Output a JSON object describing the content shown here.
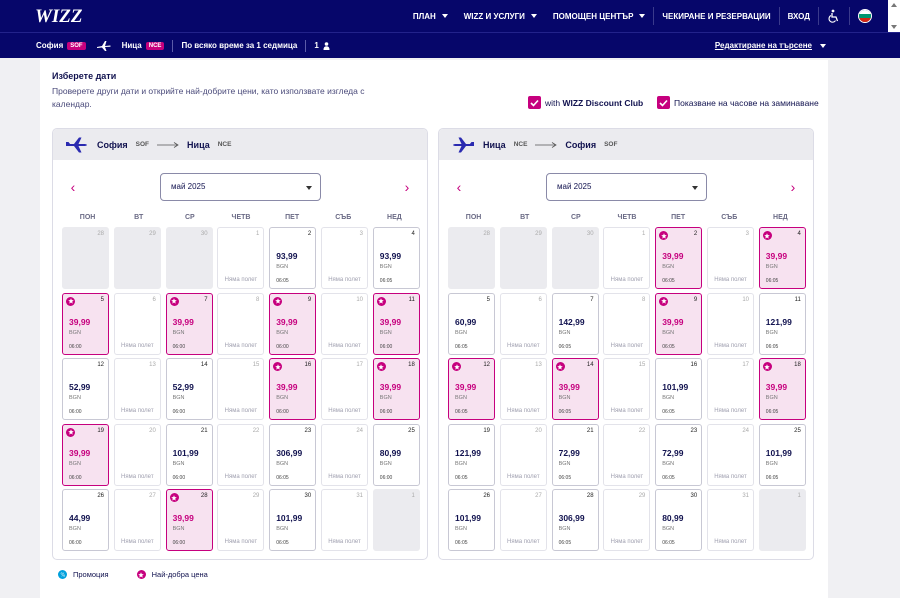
{
  "nav": {
    "logo": "WIZZ",
    "items": [
      {
        "label": "ПЛАН",
        "dropdown": true
      },
      {
        "label": "WIZZ И УСЛУГИ",
        "dropdown": true
      },
      {
        "label": "ПОМОЩЕН ЦЕНТЪР",
        "dropdown": true
      },
      {
        "label": "ЧЕКИРАНЕ И РЕЗЕРВАЦИИ",
        "dropdown": false
      },
      {
        "label": "ВХОД",
        "dropdown": false
      }
    ]
  },
  "search": {
    "origin": "София",
    "origin_code": "SOF",
    "destination": "Ница",
    "destination_code": "NCE",
    "period": "По всяко време за 1 седмица",
    "passengers": "1",
    "edit_label": "Редактиране на търсене"
  },
  "page": {
    "title": "Изберете дати",
    "subtitle": "Проверете други дати и открийте най-добрите цени, като използвате изгледа с календар.",
    "discount_club_prefix": "with ",
    "discount_club_bold": "WIZZ Discount Club",
    "show_times_label": "Показване на часове на заминаване"
  },
  "weekdays": [
    "ПОН",
    "ВТ",
    "СР",
    "ЧЕТВ",
    "ПЕТ",
    "СЪБ",
    "НЕД"
  ],
  "no_flight_label": "Няма полет",
  "currency": "BGN",
  "colors": {
    "brand_navy": "#06066a",
    "accent_pink": "#c6007e",
    "promo_blue": "#00a0dc"
  },
  "calendars": [
    {
      "from": "София",
      "from_code": "SOF",
      "to": "Ница",
      "to_code": "NCE",
      "month": "май 2025",
      "days": [
        {
          "d": "28",
          "s": "empty"
        },
        {
          "d": "29",
          "s": "empty"
        },
        {
          "d": "30",
          "s": "empty"
        },
        {
          "d": "1",
          "s": "none"
        },
        {
          "d": "2",
          "s": "price",
          "p": "93,99",
          "t": "06:05"
        },
        {
          "d": "3",
          "s": "none"
        },
        {
          "d": "4",
          "s": "price",
          "p": "93,99",
          "t": "06:05"
        },
        {
          "d": "5",
          "s": "best",
          "p": "39,99",
          "t": "06:00"
        },
        {
          "d": "6",
          "s": "none"
        },
        {
          "d": "7",
          "s": "best",
          "p": "39,99",
          "t": "06:00"
        },
        {
          "d": "8",
          "s": "none"
        },
        {
          "d": "9",
          "s": "best",
          "p": "39,99",
          "t": "06:00"
        },
        {
          "d": "10",
          "s": "none"
        },
        {
          "d": "11",
          "s": "best",
          "p": "39,99",
          "t": "06:00"
        },
        {
          "d": "12",
          "s": "price",
          "p": "52,99",
          "t": "06:00"
        },
        {
          "d": "13",
          "s": "none"
        },
        {
          "d": "14",
          "s": "price",
          "p": "52,99",
          "t": "06:00"
        },
        {
          "d": "15",
          "s": "none"
        },
        {
          "d": "16",
          "s": "best",
          "p": "39,99",
          "t": "06:00"
        },
        {
          "d": "17",
          "s": "none"
        },
        {
          "d": "18",
          "s": "best",
          "p": "39,99",
          "t": "06:00"
        },
        {
          "d": "19",
          "s": "best",
          "p": "39,99",
          "t": "06:00"
        },
        {
          "d": "20",
          "s": "none"
        },
        {
          "d": "21",
          "s": "price",
          "p": "101,99",
          "t": "06:00"
        },
        {
          "d": "22",
          "s": "none"
        },
        {
          "d": "23",
          "s": "price",
          "p": "306,99",
          "t": "06:05"
        },
        {
          "d": "24",
          "s": "none"
        },
        {
          "d": "25",
          "s": "price",
          "p": "80,99",
          "t": "06:00"
        },
        {
          "d": "26",
          "s": "price",
          "p": "44,99",
          "t": "06:00"
        },
        {
          "d": "27",
          "s": "none"
        },
        {
          "d": "28",
          "s": "best",
          "p": "39,99",
          "t": "06:00"
        },
        {
          "d": "29",
          "s": "none"
        },
        {
          "d": "30",
          "s": "price",
          "p": "101,99",
          "t": "06:05"
        },
        {
          "d": "31",
          "s": "none"
        },
        {
          "d": "1",
          "s": "empty"
        }
      ]
    },
    {
      "from": "Ница",
      "from_code": "NCE",
      "to": "София",
      "to_code": "SOF",
      "month": "май 2025",
      "days": [
        {
          "d": "28",
          "s": "empty"
        },
        {
          "d": "29",
          "s": "empty"
        },
        {
          "d": "30",
          "s": "empty"
        },
        {
          "d": "1",
          "s": "none"
        },
        {
          "d": "2",
          "s": "best",
          "p": "39,99",
          "t": "06:05"
        },
        {
          "d": "3",
          "s": "none"
        },
        {
          "d": "4",
          "s": "best",
          "p": "39,99",
          "t": "06:05"
        },
        {
          "d": "5",
          "s": "price",
          "p": "60,99",
          "t": "06:05"
        },
        {
          "d": "6",
          "s": "none"
        },
        {
          "d": "7",
          "s": "price",
          "p": "142,99",
          "t": "06:05"
        },
        {
          "d": "8",
          "s": "none"
        },
        {
          "d": "9",
          "s": "best",
          "p": "39,99",
          "t": "06:05"
        },
        {
          "d": "10",
          "s": "none"
        },
        {
          "d": "11",
          "s": "price",
          "p": "121,99",
          "t": "06:05"
        },
        {
          "d": "12",
          "s": "best",
          "p": "39,99",
          "t": "06:05"
        },
        {
          "d": "13",
          "s": "none"
        },
        {
          "d": "14",
          "s": "best",
          "p": "39,99",
          "t": "06:05"
        },
        {
          "d": "15",
          "s": "none"
        },
        {
          "d": "16",
          "s": "price",
          "p": "101,99",
          "t": "06:05"
        },
        {
          "d": "17",
          "s": "none"
        },
        {
          "d": "18",
          "s": "best",
          "p": "39,99",
          "t": "06:05"
        },
        {
          "d": "19",
          "s": "price",
          "p": "121,99",
          "t": "06:05"
        },
        {
          "d": "20",
          "s": "none"
        },
        {
          "d": "21",
          "s": "price",
          "p": "72,99",
          "t": "06:05"
        },
        {
          "d": "22",
          "s": "none"
        },
        {
          "d": "23",
          "s": "price",
          "p": "72,99",
          "t": "06:05"
        },
        {
          "d": "24",
          "s": "none"
        },
        {
          "d": "25",
          "s": "price",
          "p": "101,99",
          "t": "06:05"
        },
        {
          "d": "26",
          "s": "price",
          "p": "101,99",
          "t": "06:05"
        },
        {
          "d": "27",
          "s": "none"
        },
        {
          "d": "28",
          "s": "price",
          "p": "306,99",
          "t": "06:05"
        },
        {
          "d": "29",
          "s": "none"
        },
        {
          "d": "30",
          "s": "price",
          "p": "80,99",
          "t": "06:05"
        },
        {
          "d": "31",
          "s": "none"
        },
        {
          "d": "1",
          "s": "empty"
        }
      ]
    }
  ],
  "legend": {
    "promo": "Промоция",
    "best": "Най-добра цена"
  }
}
